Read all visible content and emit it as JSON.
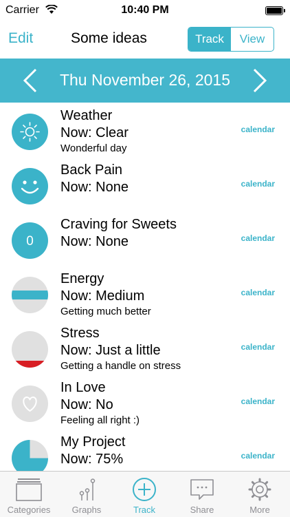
{
  "status": {
    "carrier": "Carrier",
    "time": "10:40 PM"
  },
  "nav": {
    "edit": "Edit",
    "title": "Some ideas",
    "segments": [
      "Track",
      "View"
    ],
    "active_segment": "Track"
  },
  "date": {
    "label": "Thu November 26, 2015"
  },
  "items": [
    {
      "name": "Weather",
      "now": "Now: Clear",
      "note": "Wonderful day",
      "link": "calendar",
      "icon": "sun-icon"
    },
    {
      "name": "Back Pain",
      "now": "Now: None",
      "note": "",
      "link": "calendar",
      "icon": "smiley-icon"
    },
    {
      "name": "Craving for Sweets",
      "now": "Now: None",
      "note": "",
      "link": "calendar",
      "icon": "zero-count-icon",
      "icon_text": "0"
    },
    {
      "name": "Energy",
      "now": "Now: Medium",
      "note": "Getting much better",
      "link": "calendar",
      "icon": "medium-level-icon"
    },
    {
      "name": "Stress",
      "now": "Now: Just a little",
      "note": "Getting a handle on stress",
      "link": "calendar",
      "icon": "low-level-icon"
    },
    {
      "name": "In Love",
      "now": "Now: No",
      "note": "Feeling all right :)",
      "link": "calendar",
      "icon": "heart-icon"
    },
    {
      "name": "My Project",
      "now": "Now: 75%",
      "note": "",
      "link": "calendar",
      "icon": "pie-progress-icon",
      "progress_fraction": 0.75
    }
  ],
  "tabs": [
    {
      "label": "Categories",
      "icon": "categories-icon"
    },
    {
      "label": "Graphs",
      "icon": "graphs-icon"
    },
    {
      "label": "Track",
      "icon": "add-circle-icon"
    },
    {
      "label": "Share",
      "icon": "share-bubble-icon"
    },
    {
      "label": "More",
      "icon": "gear-icon"
    }
  ],
  "active_tab": "Track",
  "colors": {
    "accent": "#3bb3c9",
    "datebar": "#44b6cc",
    "inactive_icon": "#e0e0e0",
    "stress_low": "#d81e24"
  }
}
